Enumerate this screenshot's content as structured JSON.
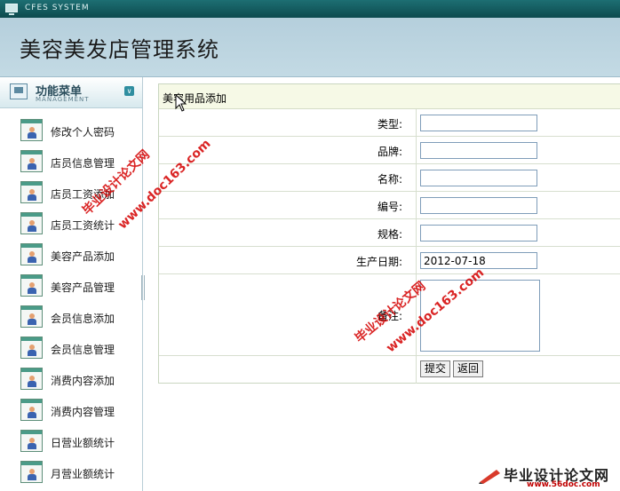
{
  "topbar": {
    "system_name": "CFES SYSTEM"
  },
  "header": {
    "title": "美容美发店管理系统"
  },
  "sidebar": {
    "title": "功能菜单",
    "subtitle": "MANAGEMENT",
    "items": [
      {
        "label": "修改个人密码"
      },
      {
        "label": "店员信息管理"
      },
      {
        "label": "店员工资添加"
      },
      {
        "label": "店员工资统计"
      },
      {
        "label": "美容产品添加"
      },
      {
        "label": "美容产品管理"
      },
      {
        "label": "会员信息添加"
      },
      {
        "label": "会员信息管理"
      },
      {
        "label": "消费内容添加"
      },
      {
        "label": "消费内容管理"
      },
      {
        "label": "日营业额统计"
      },
      {
        "label": "月营业额统计"
      }
    ]
  },
  "form": {
    "title": "美容用品添加",
    "fields": {
      "type": {
        "label": "类型:",
        "value": ""
      },
      "brand": {
        "label": "品牌:",
        "value": ""
      },
      "name": {
        "label": "名称:",
        "value": ""
      },
      "code": {
        "label": "编号:",
        "value": ""
      },
      "spec": {
        "label": "规格:",
        "value": ""
      },
      "date": {
        "label": "生产日期:",
        "value": "2012-07-18"
      },
      "remark": {
        "label": "备注:",
        "value": ""
      }
    },
    "submit_label": "提交",
    "back_label": "返回"
  },
  "watermark": {
    "site_cn": "毕业设计论文网",
    "site_url": "www.doc163.com",
    "brand_cn": "毕业设计论文网",
    "brand_url": "www.56doc.com"
  },
  "colors": {
    "topbar": "#0d4a4e",
    "header": "#c3dae4",
    "form_header": "#f6f9e6",
    "watermark": "#d40000"
  }
}
